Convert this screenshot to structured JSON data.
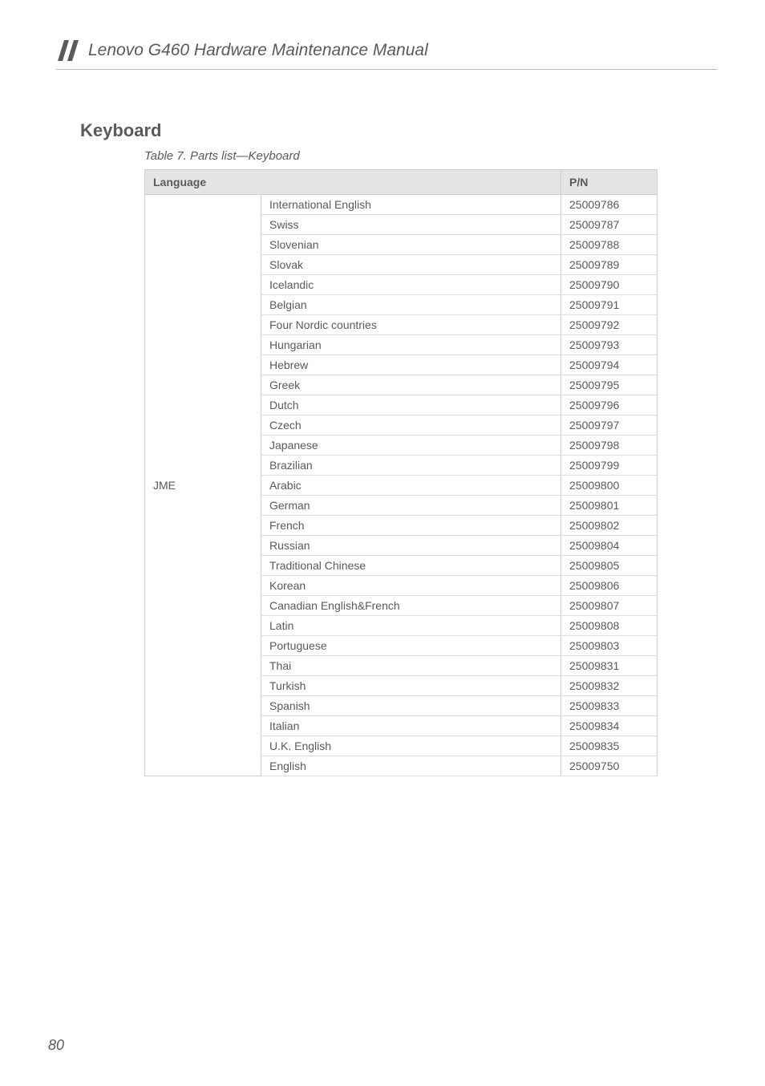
{
  "header": {
    "title": "Lenovo G460 Hardware Maintenance Manual"
  },
  "section": {
    "title": "Keyboard",
    "caption": "Table 7. Parts list—Keyboard"
  },
  "table": {
    "headers": {
      "language": "Language",
      "pn": "P/N"
    },
    "group_label": "JME",
    "rows": [
      {
        "desc": "International English",
        "pn": "25009786"
      },
      {
        "desc": "Swiss",
        "pn": "25009787"
      },
      {
        "desc": "Slovenian",
        "pn": "25009788"
      },
      {
        "desc": "Slovak",
        "pn": "25009789"
      },
      {
        "desc": "Icelandic",
        "pn": "25009790"
      },
      {
        "desc": "Belgian",
        "pn": "25009791"
      },
      {
        "desc": "Four Nordic countries",
        "pn": "25009792"
      },
      {
        "desc": "Hungarian",
        "pn": "25009793"
      },
      {
        "desc": "Hebrew",
        "pn": "25009794"
      },
      {
        "desc": "Greek",
        "pn": "25009795"
      },
      {
        "desc": "Dutch",
        "pn": "25009796"
      },
      {
        "desc": "Czech",
        "pn": "25009797"
      },
      {
        "desc": "Japanese",
        "pn": "25009798"
      },
      {
        "desc": "Brazilian",
        "pn": "25009799"
      },
      {
        "desc": "Arabic",
        "pn": "25009800"
      },
      {
        "desc": "German",
        "pn": "25009801"
      },
      {
        "desc": "French",
        "pn": "25009802"
      },
      {
        "desc": "Russian",
        "pn": "25009804"
      },
      {
        "desc": "Traditional Chinese",
        "pn": "25009805"
      },
      {
        "desc": "Korean",
        "pn": "25009806"
      },
      {
        "desc": "Canadian English&French",
        "pn": "25009807"
      },
      {
        "desc": "Latin",
        "pn": "25009808"
      },
      {
        "desc": "Portuguese",
        "pn": "25009803"
      },
      {
        "desc": "Thai",
        "pn": "25009831"
      },
      {
        "desc": "Turkish",
        "pn": "25009832"
      },
      {
        "desc": "Spanish",
        "pn": "25009833"
      },
      {
        "desc": "Italian",
        "pn": "25009834"
      },
      {
        "desc": "U.K. English",
        "pn": "25009835"
      },
      {
        "desc": "English",
        "pn": "25009750"
      }
    ]
  },
  "page_number": "80"
}
